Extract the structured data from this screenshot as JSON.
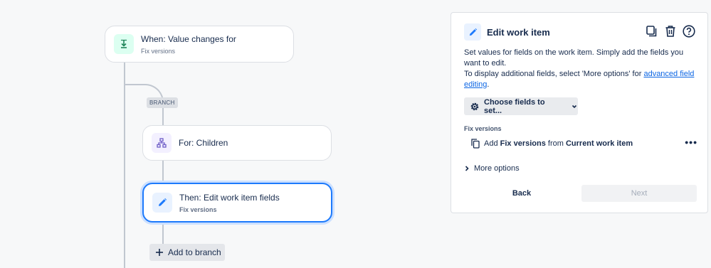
{
  "flow": {
    "trigger": {
      "title": "When: Value changes for",
      "subtitle": "Fix versions",
      "icon": "download-arrow-icon"
    },
    "branch_label": "BRANCH",
    "branch_node": {
      "title": "For: Children",
      "icon": "hierarchy-icon"
    },
    "action": {
      "title": "Then: Edit work item fields",
      "subtitle": "Fix versions",
      "icon": "pencil-icon"
    },
    "add_to_branch_label": "Add to branch"
  },
  "panel": {
    "title": "Edit work item",
    "header_icons": [
      "duplicate-icon",
      "trash-icon",
      "help-icon"
    ],
    "desc_line1": "Set values for fields on the work item. Simply add the fields you want to edit.",
    "desc_line2_prefix": "To display additional fields, select 'More options' for ",
    "desc_link": "advanced field editing",
    "desc_line2_suffix": ".",
    "choose_fields_label": "Choose fields to set...",
    "field_label": "Fix versions",
    "field_row": {
      "prefix": "Add ",
      "field": "Fix versions",
      "middle": " from ",
      "source": "Current work item",
      "more": "•••"
    },
    "more_options_label": "More options",
    "back_label": "Back",
    "next_label": "Next"
  },
  "colors": {
    "accent": "#1d7afc",
    "trigger_icon_bg": "#dcfff1",
    "trigger_icon_fg": "#1f845a",
    "branch_icon_bg": "#f3f0ff",
    "branch_icon_fg": "#6e5dc6",
    "action_icon_bg": "#e9f2ff"
  }
}
